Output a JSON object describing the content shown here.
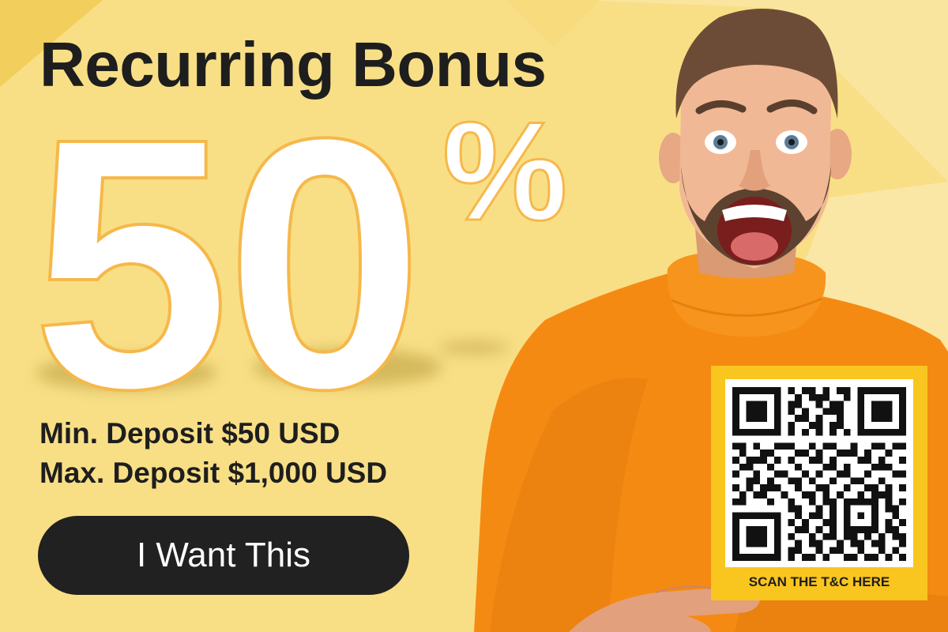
{
  "headline": "Recurring Bonus",
  "bonus": {
    "value": "50",
    "symbol": "%"
  },
  "deposit": {
    "min": "Min. Deposit $50 USD",
    "max": "Max. Deposit $1,000 USD"
  },
  "cta_label": "I Want This",
  "qr": {
    "caption": "SCAN THE T&C HERE"
  },
  "colors": {
    "background": "#f8df86",
    "text_dark": "#1e1e1e",
    "number_fill": "#ffffff",
    "number_outline": "#f6b84a",
    "button_bg": "#212121",
    "qr_frame": "#f9c51f",
    "sweater": "#f58a12"
  }
}
